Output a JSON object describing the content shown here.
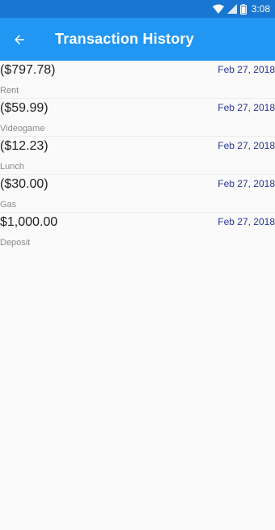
{
  "status_bar": {
    "time": "3:08",
    "icons": [
      "wifi-icon",
      "cell-signal-icon",
      "battery-icon"
    ]
  },
  "app_bar": {
    "title": "Transaction History",
    "back_icon": "arrow-back-icon"
  },
  "transactions": [
    {
      "amount": "($797.78)",
      "date": "Feb 27, 2018",
      "description": "Rent"
    },
    {
      "amount": "($59.99)",
      "date": "Feb 27, 2018",
      "description": "Videogame"
    },
    {
      "amount": "($12.23)",
      "date": "Feb 27, 2018",
      "description": "Lunch"
    },
    {
      "amount": "($30.00)",
      "date": "Feb 27, 2018",
      "description": "Gas"
    },
    {
      "amount": "$1,000.00",
      "date": "Feb 27, 2018",
      "description": "Deposit"
    }
  ],
  "colors": {
    "status_bar": "#1976d2",
    "app_bar": "#2196f3",
    "date_text": "#283593",
    "background": "#fafafa"
  }
}
